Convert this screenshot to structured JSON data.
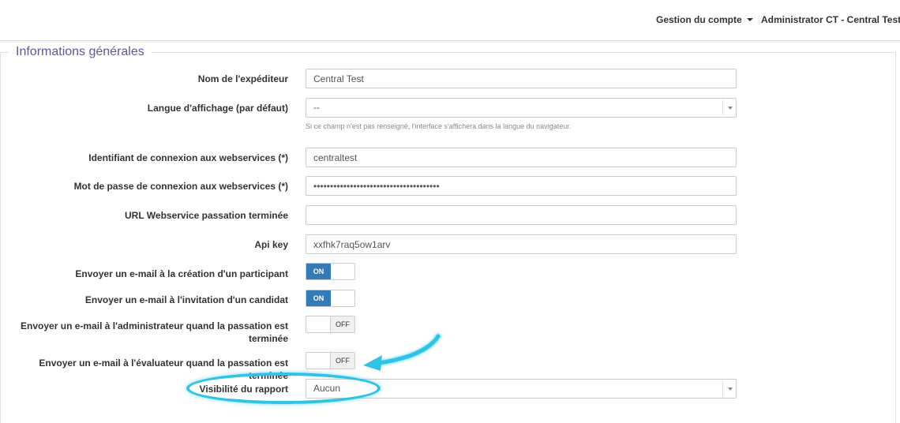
{
  "header": {
    "account_menu": "Gestion du compte",
    "user_menu": "Administrator CT - Central Test"
  },
  "section": {
    "legend": "Informations générales"
  },
  "fields": {
    "sender_name": {
      "label": "Nom de l'expéditeur",
      "value": "Central Test"
    },
    "language": {
      "label": "Langue d'affichage (par défaut)",
      "value": "--",
      "help": "Si ce champ n'est pas renseigné, l'interface s'affichera dans la langue du navigateur."
    },
    "ws_login": {
      "label": "Identifiant de connexion aux webservices (*)",
      "value": "centraltest"
    },
    "ws_password": {
      "label": "Mot de passe de connexion aux webservices (*)",
      "value": "••••••••••••••••••••••••••••••••••••••"
    },
    "ws_url": {
      "label": "URL Webservice passation terminée",
      "value": ""
    },
    "api_key": {
      "label": "Api key",
      "value": "xxfhk7raq5ow1arv"
    },
    "email_participant": {
      "label": "Envoyer un e-mail à la création d'un participant",
      "state": "ON"
    },
    "email_candidate": {
      "label": "Envoyer un e-mail à l'invitation d'un candidat",
      "state": "ON"
    },
    "email_admin": {
      "label": "Envoyer un e-mail à l'administrateur quand la passation est terminée",
      "state": "OFF"
    },
    "email_evaluator": {
      "label": "Envoyer un e-mail à l'évaluateur quand la passation est terminée",
      "state": "OFF"
    },
    "report_visibility": {
      "label": "Visibilité du rapport",
      "value": "Aucun"
    }
  },
  "colors": {
    "accent": "#337ab7",
    "annotation": "#2fc3e8",
    "legend": "#5a5a9c"
  }
}
